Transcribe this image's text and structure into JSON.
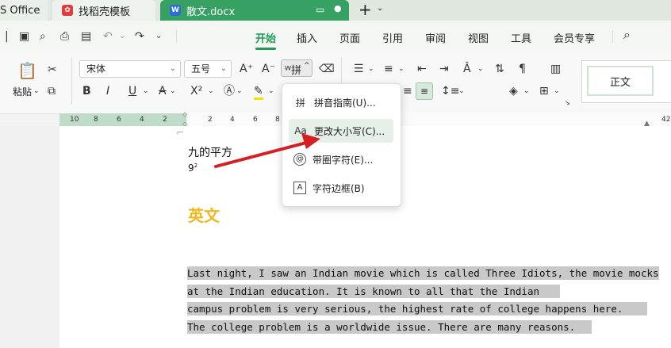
{
  "tabs": [
    {
      "label": "S Office"
    },
    {
      "label": "找稻壳模板"
    },
    {
      "label": "散文.docx"
    }
  ],
  "menu": [
    "开始",
    "插入",
    "页面",
    "引用",
    "审阅",
    "视图",
    "工具",
    "会员专享"
  ],
  "ribbon": {
    "paste_label": "粘贴",
    "font_name": "宋体",
    "font_size": "五号",
    "style_normal": "正文"
  },
  "ruler_numbers": [
    "10",
    "8",
    "6",
    "4",
    "2",
    "2",
    "4",
    "6",
    "8",
    "42"
  ],
  "document": {
    "line1": "九的平方",
    "line2": "9",
    "superscript": "2",
    "heading": "英文",
    "para_lines": [
      "Last night, I saw an Indian movie which is called Three Idiots, the movie mocks",
      "at the Indian education. It is known to all that the Indian",
      "campus problem is very serious, the highest rate of college happens here.",
      "The college problem is a worldwide issue. There are many reasons."
    ]
  },
  "dropdown": {
    "items": [
      {
        "icon": "拼",
        "label": "拼音指南(U)..."
      },
      {
        "icon": "Aa",
        "label": "更改大小写(C)..."
      },
      {
        "icon": "@",
        "label": "带圈字符(E)..."
      },
      {
        "icon": "A",
        "label": "字符边框(B)"
      }
    ]
  },
  "colors": {
    "accent": "#1e9e54",
    "doc_tab": "#36a163",
    "heading": "#f0b81e",
    "arrow": "#d42020"
  }
}
